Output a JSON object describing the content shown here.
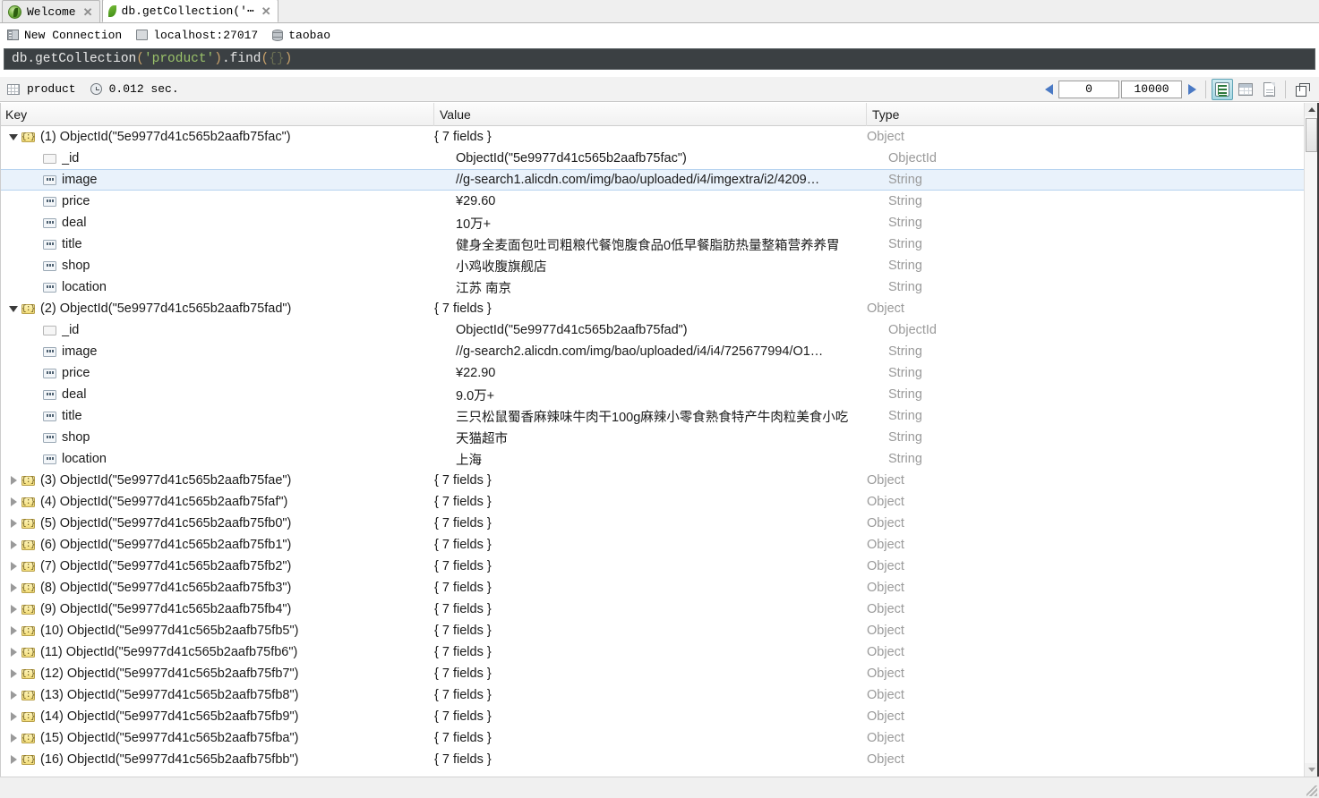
{
  "tabs": [
    {
      "label": "Welcome",
      "icon": "mongodb-leaf-circle-icon",
      "close": "✕",
      "active": false
    },
    {
      "label": "db.getCollection('⋯",
      "icon": "mongodb-leaf-icon",
      "close": "✕",
      "active": true
    }
  ],
  "breadcrumb": {
    "connection": "New Connection",
    "host": "localhost:27017",
    "database": "taobao"
  },
  "query": {
    "prefix": "db.getCollection",
    "open_paren": "(",
    "string": "'product'",
    "close_paren": ")",
    "method": ".find",
    "method_open": "(",
    "braces": "{}",
    "method_close": ")",
    "full_text": "db.getCollection('product').find({})"
  },
  "result_toolbar": {
    "collection": "product",
    "time": "0.012 sec.",
    "skip_value": "0",
    "limit_value": "10000",
    "prev_label": "◀",
    "next_label": "▶",
    "view_buttons": [
      {
        "name": "tree-view-button",
        "selected": true
      },
      {
        "name": "table-view-button",
        "selected": false
      },
      {
        "name": "text-view-button",
        "selected": false
      }
    ],
    "maximize_label": "maximize-icon"
  },
  "columns": {
    "key": "Key",
    "value": "Value",
    "type": "Type"
  },
  "types": {
    "object": "Object",
    "objectid": "ObjectId",
    "string": "String"
  },
  "rows": [
    {
      "level": 0,
      "twisty": "open",
      "icon": "object",
      "key": "(1) ObjectId(\"5e9977d41c565b2aafb75fac\")",
      "value": "{ 7 fields }",
      "type": "Object",
      "selected": false
    },
    {
      "level": 1,
      "twisty": "none",
      "icon": "oid",
      "key": "_id",
      "value": "ObjectId(\"5e9977d41c565b2aafb75fac\")",
      "type": "ObjectId",
      "selected": false
    },
    {
      "level": 1,
      "twisty": "none",
      "icon": "str",
      "key": "image",
      "value": "//g-search1.alicdn.com/img/bao/uploaded/i4/imgextra/i2/4209…",
      "type": "String",
      "selected": true
    },
    {
      "level": 1,
      "twisty": "none",
      "icon": "str",
      "key": "price",
      "value": "¥29.60",
      "type": "String",
      "selected": false
    },
    {
      "level": 1,
      "twisty": "none",
      "icon": "str",
      "key": "deal",
      "value": "10万+",
      "type": "String",
      "selected": false
    },
    {
      "level": 1,
      "twisty": "none",
      "icon": "str",
      "key": "title",
      "value": "健身全麦面包吐司粗粮代餐饱腹食品0低早餐脂肪热量整箱营养养胃",
      "type": "String",
      "selected": false
    },
    {
      "level": 1,
      "twisty": "none",
      "icon": "str",
      "key": "shop",
      "value": "小鸡收腹旗舰店",
      "type": "String",
      "selected": false
    },
    {
      "level": 1,
      "twisty": "none",
      "icon": "str",
      "key": "location",
      "value": "江苏 南京",
      "type": "String",
      "selected": false
    },
    {
      "level": 0,
      "twisty": "open",
      "icon": "object",
      "key": "(2) ObjectId(\"5e9977d41c565b2aafb75fad\")",
      "value": "{ 7 fields }",
      "type": "Object",
      "selected": false
    },
    {
      "level": 1,
      "twisty": "none",
      "icon": "oid",
      "key": "_id",
      "value": "ObjectId(\"5e9977d41c565b2aafb75fad\")",
      "type": "ObjectId",
      "selected": false
    },
    {
      "level": 1,
      "twisty": "none",
      "icon": "str",
      "key": "image",
      "value": "//g-search2.alicdn.com/img/bao/uploaded/i4/i4/725677994/O1…",
      "type": "String",
      "selected": false
    },
    {
      "level": 1,
      "twisty": "none",
      "icon": "str",
      "key": "price",
      "value": "¥22.90",
      "type": "String",
      "selected": false
    },
    {
      "level": 1,
      "twisty": "none",
      "icon": "str",
      "key": "deal",
      "value": "9.0万+",
      "type": "String",
      "selected": false
    },
    {
      "level": 1,
      "twisty": "none",
      "icon": "str",
      "key": "title",
      "value": "三只松鼠蜀香麻辣味牛肉干100g麻辣小零食熟食特产牛肉粒美食小吃",
      "type": "String",
      "selected": false
    },
    {
      "level": 1,
      "twisty": "none",
      "icon": "str",
      "key": "shop",
      "value": "天猫超市",
      "type": "String",
      "selected": false
    },
    {
      "level": 1,
      "twisty": "none",
      "icon": "str",
      "key": "location",
      "value": "上海",
      "type": "String",
      "selected": false
    },
    {
      "level": 0,
      "twisty": "closed",
      "icon": "object",
      "key": "(3) ObjectId(\"5e9977d41c565b2aafb75fae\")",
      "value": "{ 7 fields }",
      "type": "Object",
      "selected": false
    },
    {
      "level": 0,
      "twisty": "closed",
      "icon": "object",
      "key": "(4) ObjectId(\"5e9977d41c565b2aafb75faf\")",
      "value": "{ 7 fields }",
      "type": "Object",
      "selected": false
    },
    {
      "level": 0,
      "twisty": "closed",
      "icon": "object",
      "key": "(5) ObjectId(\"5e9977d41c565b2aafb75fb0\")",
      "value": "{ 7 fields }",
      "type": "Object",
      "selected": false
    },
    {
      "level": 0,
      "twisty": "closed",
      "icon": "object",
      "key": "(6) ObjectId(\"5e9977d41c565b2aafb75fb1\")",
      "value": "{ 7 fields }",
      "type": "Object",
      "selected": false
    },
    {
      "level": 0,
      "twisty": "closed",
      "icon": "object",
      "key": "(7) ObjectId(\"5e9977d41c565b2aafb75fb2\")",
      "value": "{ 7 fields }",
      "type": "Object",
      "selected": false
    },
    {
      "level": 0,
      "twisty": "closed",
      "icon": "object",
      "key": "(8) ObjectId(\"5e9977d41c565b2aafb75fb3\")",
      "value": "{ 7 fields }",
      "type": "Object",
      "selected": false
    },
    {
      "level": 0,
      "twisty": "closed",
      "icon": "object",
      "key": "(9) ObjectId(\"5e9977d41c565b2aafb75fb4\")",
      "value": "{ 7 fields }",
      "type": "Object",
      "selected": false
    },
    {
      "level": 0,
      "twisty": "closed",
      "icon": "object",
      "key": "(10) ObjectId(\"5e9977d41c565b2aafb75fb5\")",
      "value": "{ 7 fields }",
      "type": "Object",
      "selected": false
    },
    {
      "level": 0,
      "twisty": "closed",
      "icon": "object",
      "key": "(11) ObjectId(\"5e9977d41c565b2aafb75fb6\")",
      "value": "{ 7 fields }",
      "type": "Object",
      "selected": false
    },
    {
      "level": 0,
      "twisty": "closed",
      "icon": "object",
      "key": "(12) ObjectId(\"5e9977d41c565b2aafb75fb7\")",
      "value": "{ 7 fields }",
      "type": "Object",
      "selected": false
    },
    {
      "level": 0,
      "twisty": "closed",
      "icon": "object",
      "key": "(13) ObjectId(\"5e9977d41c565b2aafb75fb8\")",
      "value": "{ 7 fields }",
      "type": "Object",
      "selected": false
    },
    {
      "level": 0,
      "twisty": "closed",
      "icon": "object",
      "key": "(14) ObjectId(\"5e9977d41c565b2aafb75fb9\")",
      "value": "{ 7 fields }",
      "type": "Object",
      "selected": false
    },
    {
      "level": 0,
      "twisty": "closed",
      "icon": "object",
      "key": "(15) ObjectId(\"5e9977d41c565b2aafb75fba\")",
      "value": "{ 7 fields }",
      "type": "Object",
      "selected": false
    },
    {
      "level": 0,
      "twisty": "closed",
      "icon": "object",
      "key": "(16) ObjectId(\"5e9977d41c565b2aafb75fbb\")",
      "value": "{ 7 fields }",
      "type": "Object",
      "selected": false
    }
  ],
  "colors": {
    "selection": "#e9f2fb",
    "editor_bg": "#3b4043",
    "string_token": "#9ac26a",
    "paren_token": "#c9a26b",
    "type_text": "#9a9a9a",
    "accent": "#4a79c4"
  }
}
